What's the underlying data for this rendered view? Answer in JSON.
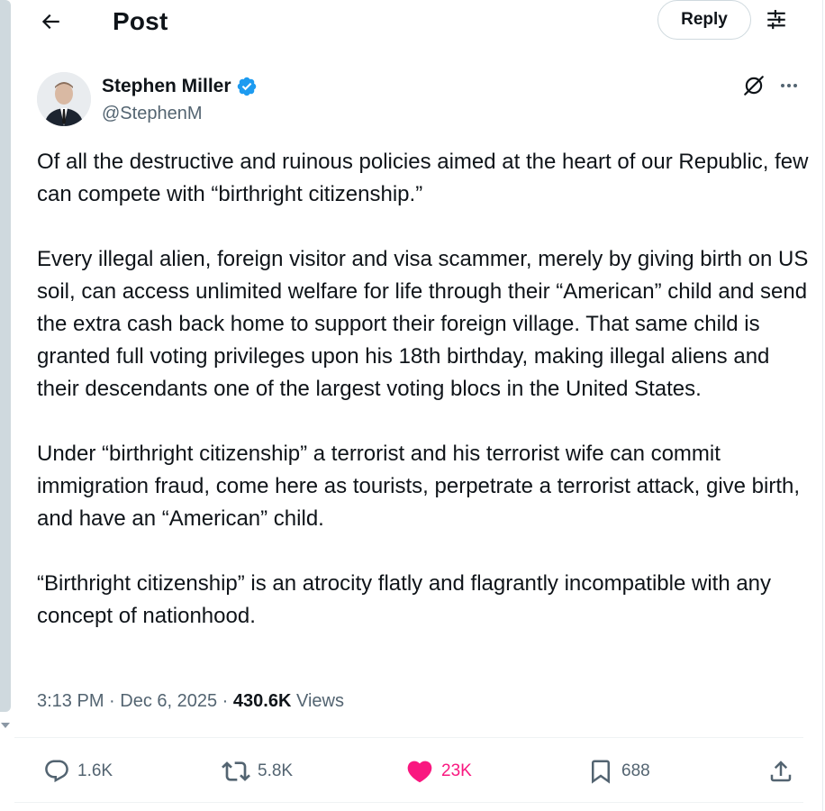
{
  "header": {
    "title": "Post",
    "reply_label": "Reply",
    "back_icon": "arrow-left-icon",
    "filter_icon": "sliders-icon"
  },
  "author": {
    "name": "Stephen Miller",
    "handle": "@StephenM",
    "verified": true,
    "verified_color": "#1d9bf0"
  },
  "post": {
    "paragraphs": [
      "Of all the destructive and ruinous policies aimed at the heart of our Republic, few can compete with “birthright citizenship.”",
      "Every illegal alien, foreign visitor and visa scammer, merely by giving birth on US soil, can access unlimited welfare for life through their “American” child and send the extra cash back home to support their foreign village. That same child is granted full voting privileges upon his 18th birthday, making illegal aliens and their descendants one of the largest voting blocs in the United States.",
      "Under “birthright citizenship” a terrorist and his terrorist wife can commit immigration fraud, come here as tourists, perpetrate a terrorist attack, give birth, and have an “American” child.",
      "“Birthright citizenship” is an atrocity flatly and flagrantly incompatible with any concept of nationhood."
    ]
  },
  "meta": {
    "time": "3:13 PM",
    "separator": " · ",
    "date": "Dec 6, 2025",
    "views_count": "430.6K",
    "views_label": "Views"
  },
  "actions": {
    "replies": "1.6K",
    "reposts": "5.8K",
    "likes": "23K",
    "bookmarks": "688",
    "like_color": "#f91880"
  }
}
